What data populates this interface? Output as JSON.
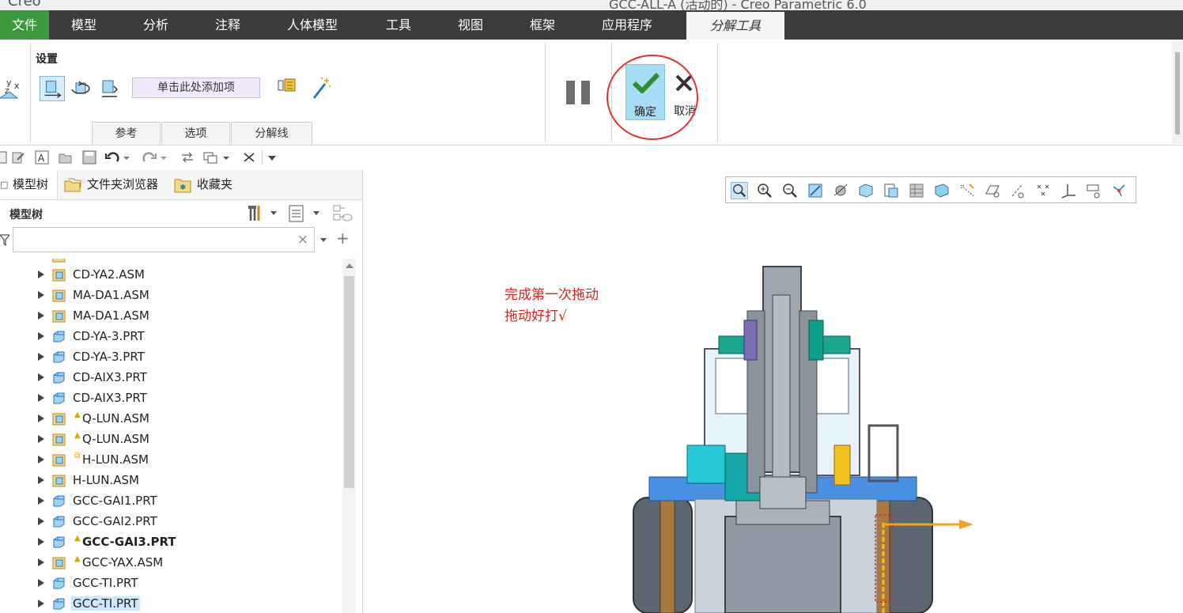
{
  "window": {
    "app_name": "Creo",
    "title": "GCC-ALL-A (活动的) - Creo Parametric 6.0"
  },
  "menu": {
    "file": "文件",
    "tabs": [
      "模型",
      "分析",
      "注释",
      "人体模型",
      "工具",
      "视图",
      "框架",
      "应用程序"
    ],
    "active_tab": "分解工具"
  },
  "ribbon": {
    "group_title": "设置",
    "add_item_label": "单击此处添加项",
    "subtabs": [
      "参考",
      "选项",
      "分解线"
    ],
    "confirm_label": "确定",
    "cancel_label": "取消"
  },
  "navigator": {
    "tabs": [
      "模型树",
      "文件夹浏览器",
      "收藏夹"
    ],
    "tree_title": "模型树",
    "search_value": "",
    "items": [
      {
        "name": "CD-YA2.ASM",
        "type": "asm",
        "mark": "",
        "bold": false,
        "selected": false
      },
      {
        "name": "MA-DA1.ASM",
        "type": "asm",
        "mark": "",
        "bold": false,
        "selected": false
      },
      {
        "name": "MA-DA1.ASM",
        "type": "asm",
        "mark": "",
        "bold": false,
        "selected": false
      },
      {
        "name": "CD-YA-3.PRT",
        "type": "prt",
        "mark": "",
        "bold": false,
        "selected": false
      },
      {
        "name": "CD-YA-3.PRT",
        "type": "prt",
        "mark": "",
        "bold": false,
        "selected": false
      },
      {
        "name": "CD-AIX3.PRT",
        "type": "prt",
        "mark": "",
        "bold": false,
        "selected": false
      },
      {
        "name": "CD-AIX3.PRT",
        "type": "prt",
        "mark": "",
        "bold": false,
        "selected": false
      },
      {
        "name": "Q-LUN.ASM",
        "type": "asm",
        "mark": "▲",
        "bold": false,
        "selected": false
      },
      {
        "name": "Q-LUN.ASM",
        "type": "asm",
        "mark": "▲",
        "bold": false,
        "selected": false
      },
      {
        "name": "H-LUN.ASM",
        "type": "asm",
        "mark": "⧉",
        "bold": false,
        "selected": false
      },
      {
        "name": "H-LUN.ASM",
        "type": "asm",
        "mark": "",
        "bold": false,
        "selected": false
      },
      {
        "name": "GCC-GAI1.PRT",
        "type": "prt",
        "mark": "",
        "bold": false,
        "selected": false
      },
      {
        "name": "GCC-GAI2.PRT",
        "type": "prt",
        "mark": "",
        "bold": false,
        "selected": false
      },
      {
        "name": "GCC-GAI3.PRT",
        "type": "prt",
        "mark": "▲",
        "bold": true,
        "selected": false
      },
      {
        "name": "GCC-YAX.ASM",
        "type": "asm",
        "mark": "▲",
        "bold": false,
        "selected": false
      },
      {
        "name": "GCC-TI.PRT",
        "type": "prt",
        "mark": "",
        "bold": false,
        "selected": false
      },
      {
        "name": "GCC-TI.PRT",
        "type": "prt",
        "mark": "",
        "bold": false,
        "selected": true
      }
    ]
  },
  "graphics": {
    "annotation_line1": "完成第一次拖动",
    "annotation_line2": "拖动好打√",
    "annotation_color": "#e02020"
  },
  "colors": {
    "menubar_bg": "#3b3b3b",
    "file_tab_bg": "#3c9a3c",
    "confirm_bg": "#a7dcf5",
    "highlight_circle": "#e53030",
    "selection_bg": "#cde8fb"
  }
}
